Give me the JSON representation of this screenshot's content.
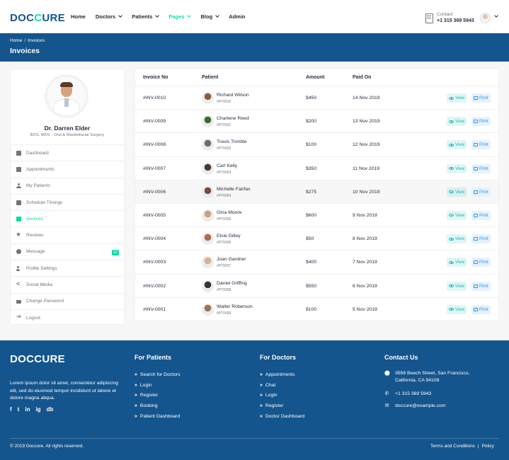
{
  "brand": {
    "logo_main": "DOC",
    "logo_accent": "C",
    "logo_end": "URE"
  },
  "nav": [
    {
      "label": "Home",
      "dropdown": false,
      "active": false
    },
    {
      "label": "Doctors",
      "dropdown": true,
      "active": false
    },
    {
      "label": "Patients",
      "dropdown": true,
      "active": false
    },
    {
      "label": "Pages",
      "dropdown": true,
      "active": true
    },
    {
      "label": "Blog",
      "dropdown": true,
      "active": false
    },
    {
      "label": "Admin",
      "dropdown": false,
      "active": false
    }
  ],
  "header_contact": {
    "label": "Contact",
    "phone": "+1 315 369 5943"
  },
  "breadcrumb": {
    "home": "Home",
    "separator": "/",
    "current": "Invoices",
    "title": "Invoices"
  },
  "doctor": {
    "name": "Dr. Darren Elder",
    "specialty": "BDS, MDS - Oral & Maxillofacial Surgery"
  },
  "sidebar_menu": [
    {
      "label": "Dashboard",
      "icon": "dashboard-icon"
    },
    {
      "label": "Appointments",
      "icon": "calendar-icon"
    },
    {
      "label": "My Patients",
      "icon": "user-injured-icon"
    },
    {
      "label": "Schedule Timings",
      "icon": "hourglass-icon"
    },
    {
      "label": "Invoices",
      "icon": "file-invoice-icon",
      "active": true
    },
    {
      "label": "Reviews",
      "icon": "star-icon"
    },
    {
      "label": "Message",
      "icon": "comments-icon",
      "badge": "23"
    },
    {
      "label": "Profile Settings",
      "icon": "user-cog-icon"
    },
    {
      "label": "Social Media",
      "icon": "share-icon"
    },
    {
      "label": "Change Password",
      "icon": "lock-icon"
    },
    {
      "label": "Logout",
      "icon": "sign-out-icon"
    }
  ],
  "table": {
    "headers": {
      "invoice": "Invoice No",
      "patient": "Patient",
      "amount": "Amount",
      "paid_on": "Paid On"
    },
    "view_label": "View",
    "print_label": "Print",
    "rows": [
      {
        "invoice": "#INV-0010",
        "name": "Richard Wilson",
        "pid": "#PT0016",
        "amount": "$450",
        "date": "14 Nov 2019"
      },
      {
        "invoice": "#INV-0009",
        "name": "Charlene Reed",
        "pid": "#PT0001",
        "amount": "$200",
        "date": "13 Nov 2019"
      },
      {
        "invoice": "#INV-0008",
        "name": "Travis Trimble",
        "pid": "#PT0002",
        "amount": "$100",
        "date": "12 Nov 2019"
      },
      {
        "invoice": "#INV-0007",
        "name": "Carl Kelly",
        "pid": "#PT0003",
        "amount": "$350",
        "date": "11 Nov 2019"
      },
      {
        "invoice": "#INV-0006",
        "name": "Michelle Fairfax",
        "pid": "#PT0004",
        "amount": "$275",
        "date": "10 Nov 2019"
      },
      {
        "invoice": "#INV-0005",
        "name": "Gina Moore",
        "pid": "#PT0005",
        "amount": "$600",
        "date": "9 Nov 2019"
      },
      {
        "invoice": "#INV-0004",
        "name": "Elsie Gilley",
        "pid": "#PT0006",
        "amount": "$50",
        "date": "8 Nov 2019"
      },
      {
        "invoice": "#INV-0003",
        "name": "Joan Gardner",
        "pid": "#PT0007",
        "amount": "$400",
        "date": "7 Nov 2019"
      },
      {
        "invoice": "#INV-0002",
        "name": "Daniel Griffing",
        "pid": "#PT0008",
        "amount": "$550",
        "date": "6 Nov 2019"
      },
      {
        "invoice": "#INV-0001",
        "name": "Walter Roberson",
        "pid": "#PT0009",
        "amount": "$100",
        "date": "5 Nov 2019"
      }
    ]
  },
  "footer": {
    "about": "Lorem ipsum dolor sit amet, consectetur adipiscing elit, sed do eiusmod tempor incididunt ut labore et dolore magna aliqua.",
    "social": [
      "f",
      "t",
      "in",
      "ig",
      "db"
    ],
    "patients_title": "For Patients",
    "patients_links": [
      "Search for Doctors",
      "Login",
      "Register",
      "Booking",
      "Patient Dashboard"
    ],
    "doctors_title": "For Doctors",
    "doctors_links": [
      "Appointments",
      "Chat",
      "Login",
      "Register",
      "Doctor Dashboard"
    ],
    "contact_title": "Contact Us",
    "address_line1": "3556 Beech Street, San Francisco,",
    "address_line2": "California, CA 94108",
    "phone": "+1 315 369 5943",
    "email": "doccure@example.com",
    "copyright": "© 2019 Doccure. All rights reserved.",
    "terms": "Terms and Conditions",
    "legal_sep": "|",
    "policy": "Policy"
  },
  "colors": {
    "primary": "#15558d",
    "accent": "#09e5ab",
    "view": "#1db9aa",
    "print": "#2196f3"
  }
}
